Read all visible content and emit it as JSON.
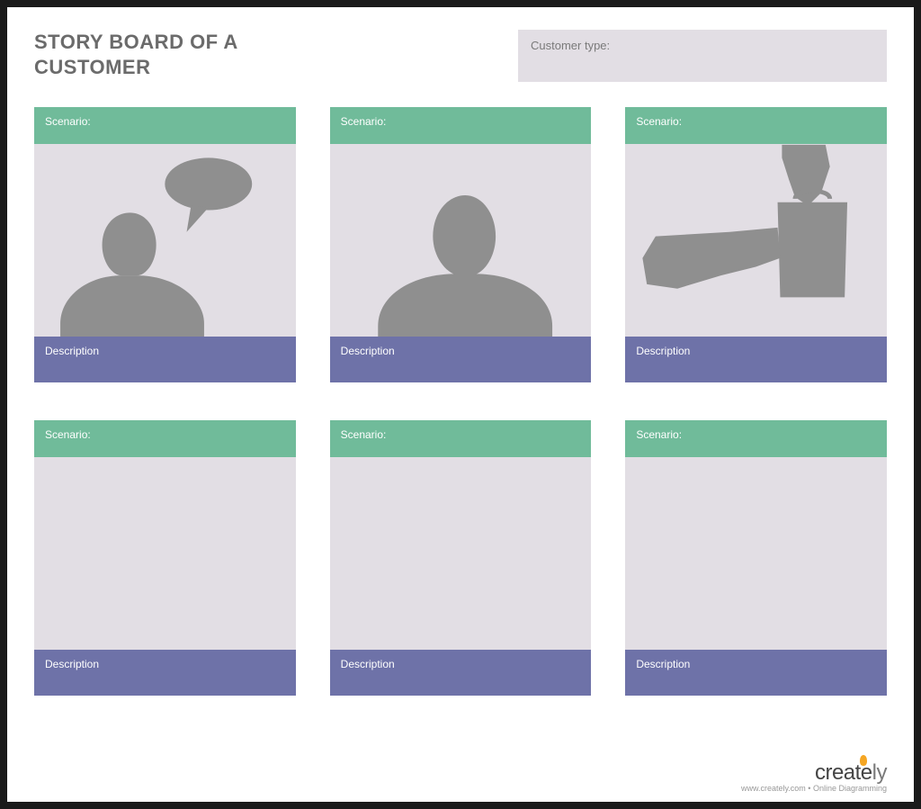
{
  "header": {
    "title": "STORY BOARD OF A CUSTOMER",
    "customer_type_label": "Customer type:"
  },
  "cards": [
    {
      "scenario_label": "Scenario:",
      "description_label": "Description",
      "illustration": "person-speech-bubble"
    },
    {
      "scenario_label": "Scenario:",
      "description_label": "Description",
      "illustration": "person-silhouette"
    },
    {
      "scenario_label": "Scenario:",
      "description_label": "Description",
      "illustration": "shopping-bag-hand"
    },
    {
      "scenario_label": "Scenario:",
      "description_label": "Description",
      "illustration": "none"
    },
    {
      "scenario_label": "Scenario:",
      "description_label": "Description",
      "illustration": "none"
    },
    {
      "scenario_label": "Scenario:",
      "description_label": "Description",
      "illustration": "none"
    }
  ],
  "footer": {
    "brand_first": "create",
    "brand_last": "ly",
    "tagline": "www.creately.com • Online Diagramming"
  },
  "colors": {
    "scenario_bg": "#70bb9a",
    "description_bg": "#6e72a8",
    "panel_bg": "#e2dee4",
    "silhouette": "#8f8f8f"
  }
}
